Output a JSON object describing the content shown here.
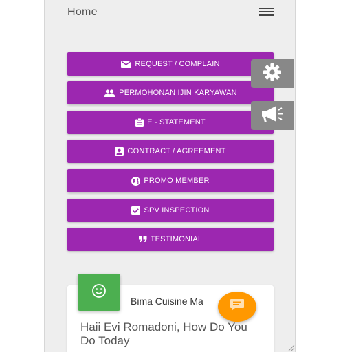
{
  "header": {
    "title": "Home"
  },
  "menu": [
    {
      "label": "REQUEST / COMPLAIN",
      "icon": "mail-icon"
    },
    {
      "label": "PERMOHONAN IJIN KARYAWAN",
      "icon": "people-icon"
    },
    {
      "label": "E - STATEMENT",
      "icon": "clipboard-icon"
    },
    {
      "label": "CONTRACT / AGREEMENT",
      "icon": "contact-card-icon"
    },
    {
      "label": "PROMO MEMBER",
      "icon": "globe-icon"
    },
    {
      "label": "SPV INSPECTION",
      "icon": "checkbox-icon"
    },
    {
      "label": "TESTIMONIAL",
      "icon": "quote-icon"
    }
  ],
  "side": {
    "settings_icon": "gear-icon",
    "announce_icon": "megaphone-icon"
  },
  "card": {
    "title": "Bima Cuisine Ma",
    "message": "Haii Evi Romadoni, How Do You Do Today",
    "avatar_icon": "smiley-icon"
  },
  "fab": {
    "icon": "chat-icon"
  },
  "colors": {
    "primary": "#9c27b0",
    "accent": "#ff9800",
    "avatar": "#4caf50",
    "side": "#888888"
  }
}
